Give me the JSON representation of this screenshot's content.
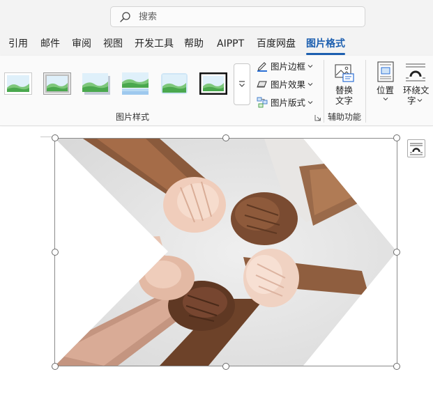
{
  "search": {
    "placeholder": "搜索",
    "icon": "search-icon"
  },
  "tabs": [
    {
      "label": "引用"
    },
    {
      "label": "邮件"
    },
    {
      "label": "审阅"
    },
    {
      "label": "视图"
    },
    {
      "label": "开发工具"
    },
    {
      "label": "帮助"
    },
    {
      "label": "AIPPT"
    },
    {
      "label": "百度网盘"
    },
    {
      "label": "图片格式",
      "active": true
    }
  ],
  "ribbon": {
    "picture_styles": {
      "label": "图片样式",
      "gallery_count": 6
    },
    "commands": [
      {
        "label": "图片边框",
        "icon": "pen-border-icon"
      },
      {
        "label": "图片效果",
        "icon": "effects-icon"
      },
      {
        "label": "图片版式",
        "icon": "layout-icon"
      }
    ],
    "accessibility": {
      "label": "辅助功能",
      "alt_text": {
        "line1": "替换",
        "line2": "文字"
      }
    },
    "arrange": {
      "position": {
        "label": "位置"
      },
      "wrap_text": {
        "line1": "环绕文",
        "line2": "字"
      }
    }
  },
  "colors": {
    "accent": "#1c5fb0",
    "ribbon_bg": "#fafafa",
    "chrome_bg": "#f3f3f3"
  },
  "document": {
    "image_subject": "hands-linked-teamwork-photo",
    "selected": true
  }
}
